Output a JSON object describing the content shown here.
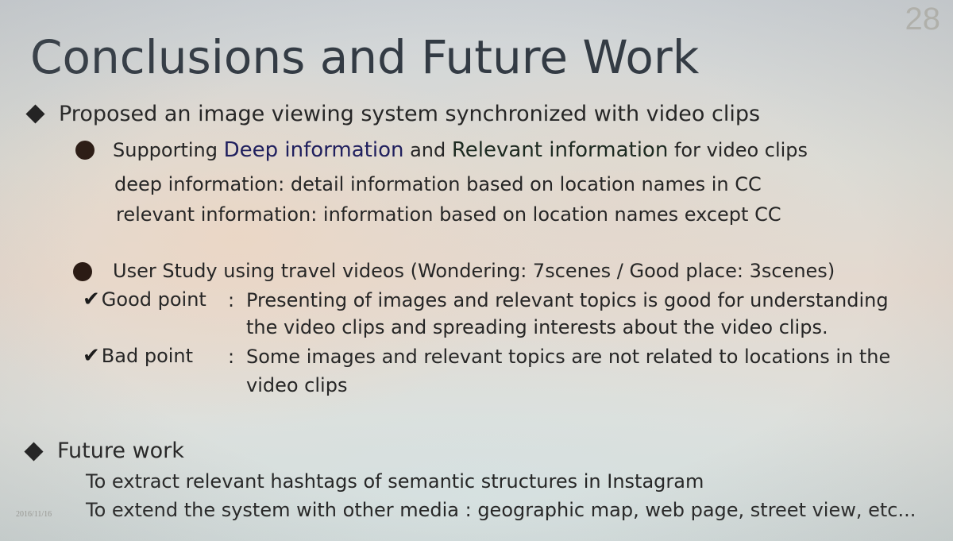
{
  "slide": {
    "page_number": "28",
    "title": "Conclusions and Future Work",
    "section1": {
      "heading": "Proposed an image viewing system synchronized with video clips",
      "bullet1": {
        "prefix": "Supporting ",
        "term1": "Deep information",
        "middle": " and ",
        "term2": "Relevant information",
        "suffix": " for video clips",
        "detail1": "deep information: detail information based on location names in CC",
        "detail2": "relevant information: information based on location names except CC"
      },
      "bullet2": {
        "text": "User Study using travel videos  (Wondering: 7scenes   /   Good place: 3scenes)",
        "good_label": "Good point",
        "good_sep": ":",
        "good_line1": "Presenting of images and relevant topics is good for understanding",
        "good_line2": "the video clips and spreading interests about the video clips.",
        "bad_label": "Bad point",
        "bad_sep": ":",
        "bad_line1": "Some images and relevant topics are not related to locations in the",
        "bad_line2": "video clips"
      }
    },
    "section2": {
      "heading": "Future work",
      "item1": "To extract relevant hashtags of semantic structures in Instagram",
      "item2": "To extend the system with other media : geographic map, web page, street view, etc..."
    },
    "date_stamp": "2016/11/16"
  },
  "icons": {
    "section_bullet": "diamond-icon",
    "sub_bullet": "dot-icon",
    "check": "check-icon"
  }
}
